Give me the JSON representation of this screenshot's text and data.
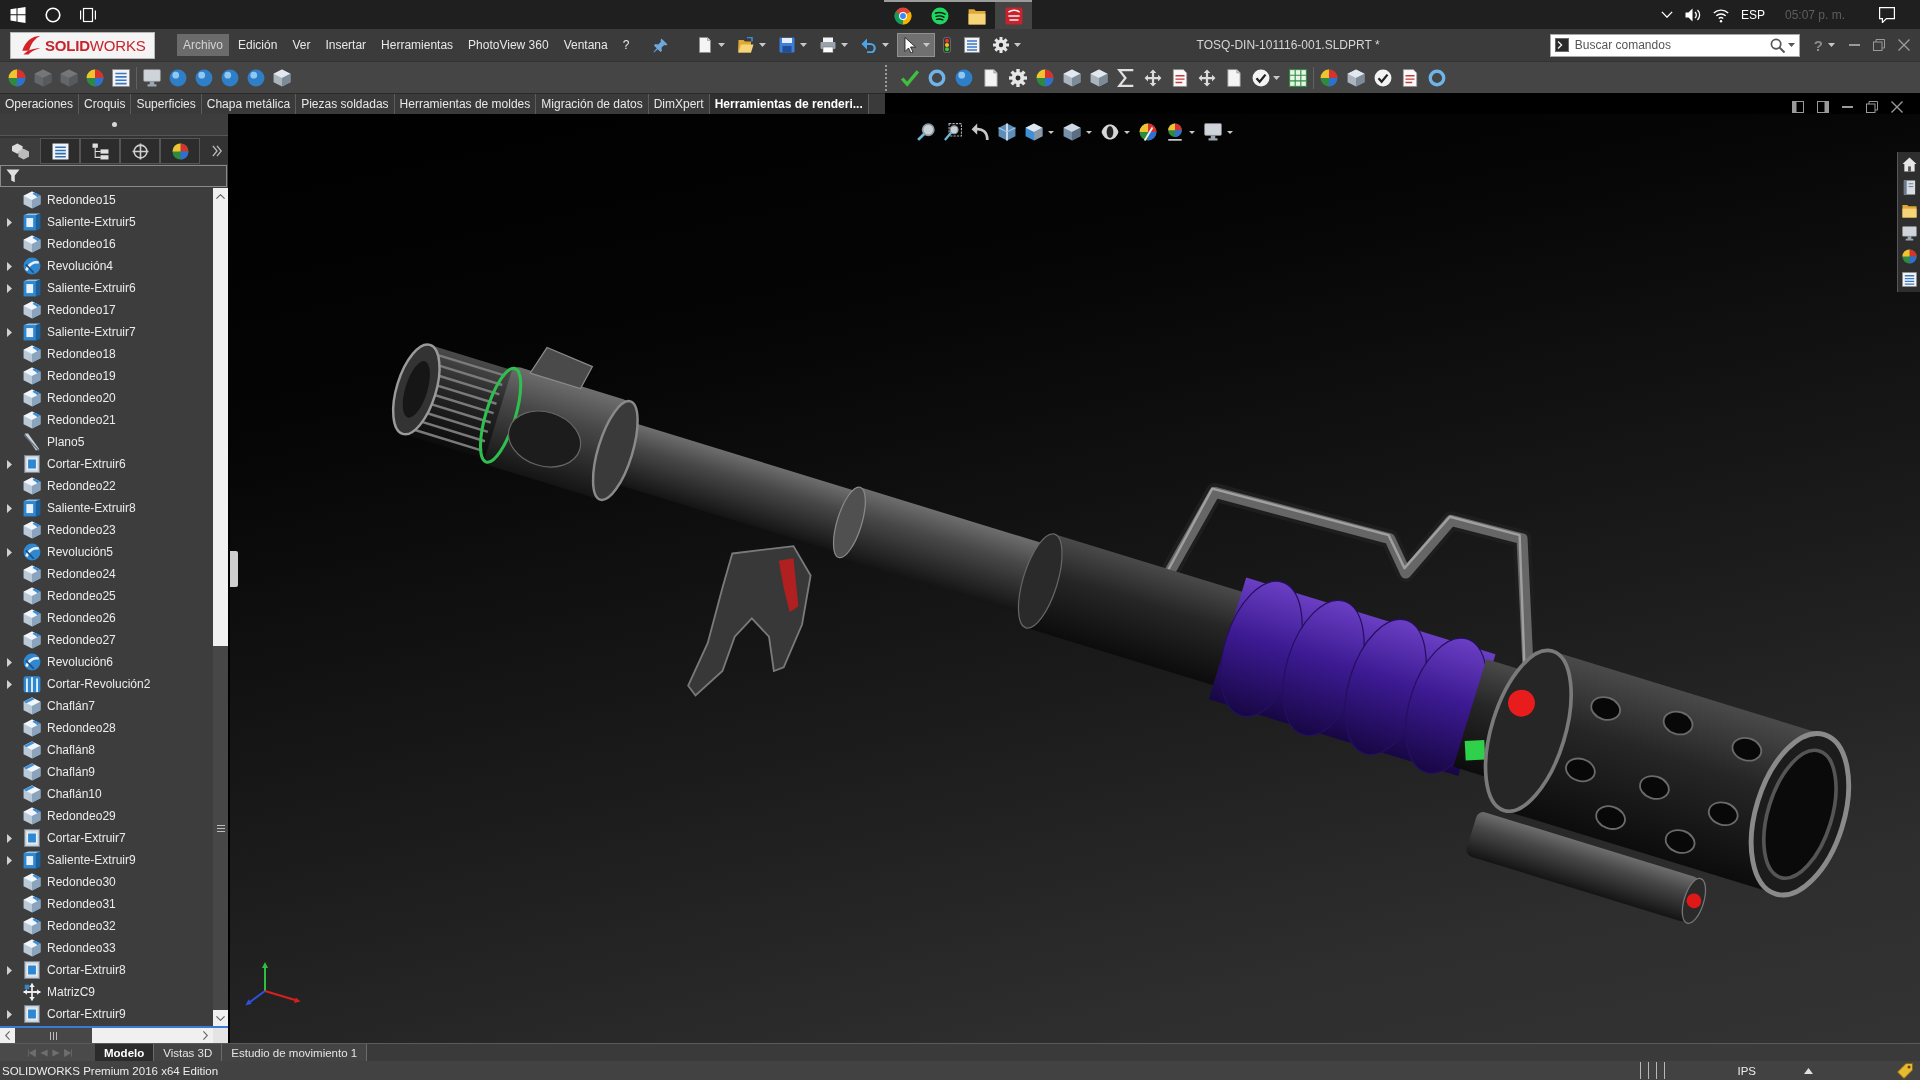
{
  "taskbar": {
    "apps": [
      {
        "kind": "browser",
        "running": true,
        "selected": false
      },
      {
        "kind": "music",
        "running": true,
        "selected": false
      },
      {
        "kind": "folder",
        "running": true,
        "selected": false
      },
      {
        "kind": "cad",
        "running": true,
        "selected": true
      }
    ],
    "language": "ESP",
    "clock": "05:07 p. m."
  },
  "menu_bar": {
    "logo": "**SOLID**WORKS",
    "menus": [
      {
        "label": "Archivo",
        "selected": true
      },
      {
        "label": "Edición",
        "selected": false
      },
      {
        "label": "Ver",
        "selected": false
      },
      {
        "label": "Insertar",
        "selected": false
      },
      {
        "label": "Herramientas",
        "selected": false
      },
      {
        "label": "PhotoView 360",
        "selected": false
      },
      {
        "label": "Ventana",
        "selected": false
      },
      {
        "label": "?",
        "selected": false
      }
    ],
    "tools": [
      {
        "kind": "page",
        "dropdown": true,
        "selected": false
      },
      {
        "kind": "openfolder",
        "dropdown": true,
        "selected": false
      },
      {
        "kind": "floppy",
        "dropdown": true,
        "selected": false
      },
      {
        "kind": "printer",
        "dropdown": true,
        "selected": false
      },
      {
        "kind": "undo",
        "dropdown": true,
        "selected": false
      },
      {
        "kind": "cursor",
        "dropdown": true,
        "selected": true
      },
      {
        "kind": "trafficlight",
        "dropdown": false,
        "selected": false
      },
      {
        "kind": "list",
        "dropdown": false,
        "selected": false
      },
      {
        "kind": "gear",
        "dropdown": true,
        "selected": false
      }
    ],
    "document_title": "TOSQ-DIN-101116-001.SLDPRT *",
    "search": {
      "placeholder": "Buscar comandos"
    },
    "help": "?"
  },
  "command_bar": {
    "groups": [
      [
        {
          "kind": "palette",
          "disabled": false,
          "dropdown": false
        },
        {
          "kind": "cube",
          "disabled": true,
          "dropdown": false
        },
        {
          "kind": "cube",
          "disabled": true,
          "dropdown": false
        },
        {
          "kind": "palette",
          "disabled": false,
          "dropdown": false
        },
        {
          "kind": "list",
          "disabled": false,
          "dropdown": false
        }
      ],
      [
        {
          "kind": "monitor",
          "disabled": false,
          "dropdown": false
        },
        {
          "kind": "sphere",
          "disabled": false,
          "dropdown": false
        },
        {
          "kind": "sphere",
          "disabled": false,
          "dropdown": false
        },
        {
          "kind": "sphere",
          "disabled": false,
          "dropdown": false
        },
        {
          "kind": "sphere",
          "disabled": false,
          "dropdown": false
        },
        {
          "kind": "cube",
          "disabled": false,
          "dropdown": false
        }
      ],
      [
        {
          "kind": "check",
          "disabled": false,
          "dropdown": false
        },
        {
          "kind": "ring",
          "disabled": false,
          "dropdown": false
        },
        {
          "kind": "sphere",
          "disabled": false,
          "dropdown": false
        },
        {
          "kind": "page",
          "disabled": false,
          "dropdown": false
        },
        {
          "kind": "gear",
          "disabled": false,
          "dropdown": false
        },
        {
          "kind": "palette",
          "disabled": false,
          "dropdown": false
        },
        {
          "kind": "cube",
          "disabled": false,
          "dropdown": false
        },
        {
          "kind": "cube",
          "disabled": false,
          "dropdown": false
        },
        {
          "kind": "sigma",
          "disabled": false,
          "dropdown": false
        },
        {
          "kind": "arrows",
          "disabled": false,
          "dropdown": false
        },
        {
          "kind": "document",
          "disabled": false,
          "dropdown": false
        },
        {
          "kind": "arrows",
          "disabled": false,
          "dropdown": false
        },
        {
          "kind": "page",
          "disabled": false,
          "dropdown": false
        },
        {
          "kind": "checkcircle",
          "disabled": false,
          "dropdown": true
        },
        {
          "kind": "spreadsheet",
          "disabled": false,
          "dropdown": false
        }
      ],
      [
        {
          "kind": "palette",
          "disabled": false,
          "dropdown": false
        },
        {
          "kind": "cube",
          "disabled": false,
          "dropdown": false
        },
        {
          "kind": "checkcircle",
          "disabled": false,
          "dropdown": false
        },
        {
          "kind": "document",
          "disabled": false,
          "dropdown": false
        },
        {
          "kind": "ring",
          "disabled": false,
          "dropdown": false
        }
      ]
    ]
  },
  "command_tabs": [
    {
      "label": "Operaciones",
      "selected": false
    },
    {
      "label": "Croquis",
      "selected": false
    },
    {
      "label": "Superficies",
      "selected": false
    },
    {
      "label": "Chapa metálica",
      "selected": false
    },
    {
      "label": "Piezas soldadas",
      "selected": false
    },
    {
      "label": "Herramientas de moldes",
      "selected": false
    },
    {
      "label": "Migración de datos",
      "selected": false
    },
    {
      "label": "DimXpert",
      "selected": false
    },
    {
      "label": "Herramientas de renderi...",
      "selected": true
    }
  ],
  "feature_tree": {
    "panel_tabs": [
      {
        "kind": "parts",
        "selected": true
      },
      {
        "kind": "propertylist",
        "selected": false
      },
      {
        "kind": "configtree",
        "selected": false
      },
      {
        "kind": "crosshair",
        "selected": false
      },
      {
        "kind": "palette",
        "selected": false
      }
    ],
    "items": [
      {
        "label": "Redondeo15",
        "kind": "fillet",
        "expandable": false
      },
      {
        "label": "Saliente-Extruir5",
        "kind": "extrude",
        "expandable": true
      },
      {
        "label": "Redondeo16",
        "kind": "fillet",
        "expandable": false
      },
      {
        "label": "Revolución4",
        "kind": "revolve",
        "expandable": true
      },
      {
        "label": "Saliente-Extruir6",
        "kind": "extrude",
        "expandable": true
      },
      {
        "label": "Redondeo17",
        "kind": "fillet",
        "expandable": false
      },
      {
        "label": "Saliente-Extruir7",
        "kind": "extrude",
        "expandable": true
      },
      {
        "label": "Redondeo18",
        "kind": "fillet",
        "expandable": false
      },
      {
        "label": "Redondeo19",
        "kind": "fillet",
        "expandable": false
      },
      {
        "label": "Redondeo20",
        "kind": "fillet",
        "expandable": false
      },
      {
        "label": "Redondeo21",
        "kind": "fillet",
        "expandable": false
      },
      {
        "label": "Plano5",
        "kind": "plane",
        "expandable": false
      },
      {
        "label": "Cortar-Extruir6",
        "kind": "cut",
        "expandable": true
      },
      {
        "label": "Redondeo22",
        "kind": "fillet",
        "expandable": false
      },
      {
        "label": "Saliente-Extruir8",
        "kind": "extrude",
        "expandable": true
      },
      {
        "label": "Redondeo23",
        "kind": "fillet",
        "expandable": false
      },
      {
        "label": "Revolución5",
        "kind": "revolve",
        "expandable": true
      },
      {
        "label": "Redondeo24",
        "kind": "fillet",
        "expandable": false
      },
      {
        "label": "Redondeo25",
        "kind": "fillet",
        "expandable": false
      },
      {
        "label": "Redondeo26",
        "kind": "fillet",
        "expandable": false
      },
      {
        "label": "Redondeo27",
        "kind": "fillet",
        "expandable": false
      },
      {
        "label": "Revolución6",
        "kind": "revolve",
        "expandable": true
      },
      {
        "label": "Cortar-Revolución2",
        "kind": "cutrevolve",
        "expandable": true
      },
      {
        "label": "Chaflán7",
        "kind": "chamfer",
        "expandable": false
      },
      {
        "label": "Redondeo28",
        "kind": "fillet",
        "expandable": false
      },
      {
        "label": "Chaflán8",
        "kind": "chamfer",
        "expandable": false
      },
      {
        "label": "Chaflán9",
        "kind": "chamfer",
        "expandable": false
      },
      {
        "label": "Chaflán10",
        "kind": "chamfer",
        "expandable": false
      },
      {
        "label": "Redondeo29",
        "kind": "fillet",
        "expandable": false
      },
      {
        "label": "Cortar-Extruir7",
        "kind": "cut",
        "expandable": true
      },
      {
        "label": "Saliente-Extruir9",
        "kind": "extrude",
        "expandable": true
      },
      {
        "label": "Redondeo30",
        "kind": "fillet",
        "expandable": false
      },
      {
        "label": "Redondeo31",
        "kind": "fillet",
        "expandable": false
      },
      {
        "label": "Redondeo32",
        "kind": "fillet",
        "expandable": false
      },
      {
        "label": "Redondeo33",
        "kind": "fillet",
        "expandable": false
      },
      {
        "label": "Cortar-Extruir8",
        "kind": "cut",
        "expandable": true
      },
      {
        "label": "MatrizC9",
        "kind": "pattern",
        "expandable": false
      },
      {
        "label": "Cortar-Extruir9",
        "kind": "cut",
        "expandable": true
      }
    ]
  },
  "bottom_bar": {
    "navigation_disabled": true,
    "tabs": [
      {
        "label": "Modelo",
        "selected": true
      },
      {
        "label": "Vistas 3D",
        "selected": false
      },
      {
        "label": "Estudio de movimiento 1",
        "selected": false
      }
    ]
  },
  "status_bar": {
    "edition": "SOLIDWORKS Premium 2016 x64 Edition",
    "units": "IPS"
  }
}
